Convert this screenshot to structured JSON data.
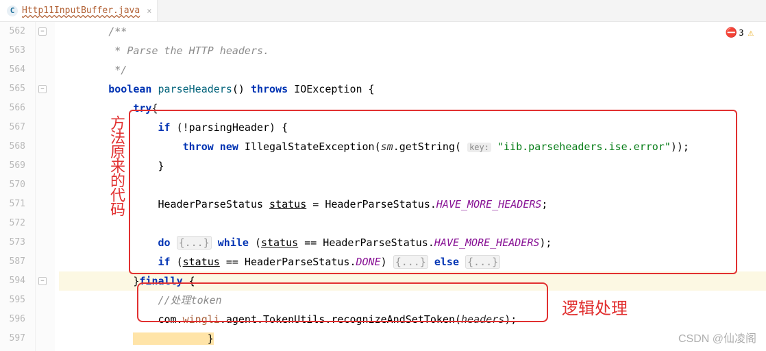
{
  "tab": {
    "filename": "Http11InputBuffer.java",
    "icon_letter": "C"
  },
  "errors": {
    "error_count": "3",
    "warn_count": ""
  },
  "gutter": [
    "562",
    "563",
    "564",
    "565",
    "566",
    "567",
    "568",
    "569",
    "570",
    "571",
    "572",
    "573",
    "587",
    "594",
    "595",
    "596",
    "597"
  ],
  "fold_marks": {
    "at": [
      0,
      3,
      13
    ],
    "glyphs": [
      "−",
      "−",
      "−"
    ]
  },
  "code": {
    "l0": "        /**",
    "l1": "         * Parse the HTTP headers.",
    "l2": "         */",
    "l3_kw1": "boolean",
    "l3_method": "parseHeaders",
    "l3_mid": "() ",
    "l3_kw2": "throws",
    "l3_exc": " IOException {",
    "l4_kw": "try",
    "l4_brace": "{",
    "l5_kw": "if",
    "l5_cond": " (!parsingHeader) {",
    "l6_kw": "throw new",
    "l6_cls": " IllegalStateException(",
    "l6_it": "sm",
    "l6_m": ".getString( ",
    "l6_hint": "key:",
    "l6_str": "\"iib.parseheaders.ise.error\"",
    "l6_end": "));",
    "l7": "                }",
    "l8": "",
    "l9_a": "                HeaderParseStatus ",
    "l9_var": "status",
    "l9_b": " = HeaderParseStatus.",
    "l9_c": "HAVE_MORE_HEADERS",
    "l9_d": ";",
    "l10": "",
    "l11_kw": "do",
    "l11_fold": "{...}",
    "l11_kw2": " while",
    "l11_a": " (",
    "l11_var": "status",
    "l11_b": " == HeaderParseStatus.",
    "l11_c": "HAVE_MORE_HEADERS",
    "l11_d": ");",
    "l12_kw": "if",
    "l12_a": " (",
    "l12_var": "status",
    "l12_b": " == HeaderParseStatus.",
    "l12_c": "DONE",
    "l12_d": ") ",
    "l12_fold1": "{...}",
    "l12_kw2": " else ",
    "l12_fold2": "{...}",
    "l13_a": "            }",
    "l13_kw": "finally",
    "l13_b": " {",
    "l14": "                //处理token",
    "l15_a": "                com.",
    "l15_pkg": "wingli",
    "l15_b": ".agent.TokenUtils.recognizeAndSetToken(",
    "l15_arg": "headers",
    "l15_c": ");",
    "l16": "            }"
  },
  "annotation": {
    "vertical": "方法原来的代码",
    "label": "逻辑处理"
  },
  "watermark": "CSDN @仙凌阁"
}
